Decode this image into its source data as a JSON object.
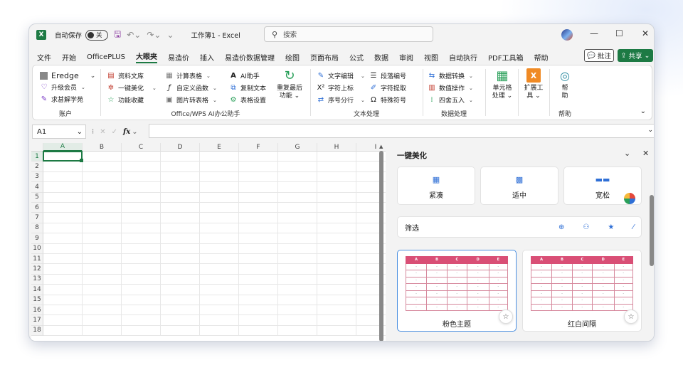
{
  "titlebar": {
    "app_icon": "X",
    "autosave_label": "自动保存",
    "autosave_state": "关",
    "doc_title": "工作簿1 - Excel",
    "search_placeholder": "搜索"
  },
  "menu": [
    "文件",
    "开始",
    "OfficePLUS",
    "大眼夹",
    "易造价",
    "插入",
    "易造价数据管理",
    "绘图",
    "页面布局",
    "公式",
    "数据",
    "审阅",
    "视图",
    "自动执行",
    "PDF工具箱",
    "帮助"
  ],
  "menu_active_index": 3,
  "header_buttons": {
    "comment": "批注",
    "share": "共享"
  },
  "ribbon": {
    "account": {
      "items": [
        "Eredge",
        "升级会员",
        "求甚解学苑"
      ],
      "label": "账户"
    },
    "assistant": {
      "col1": [
        "资料文库",
        "一键美化",
        "功能收藏"
      ],
      "col2": [
        "计算表格",
        "自定义函数",
        "图片转表格"
      ],
      "col3": [
        "AI助手",
        "复制文本",
        "表格设置"
      ],
      "label": "Office/WPS AI办公助手"
    },
    "repeat": {
      "line1": "重复最后",
      "line2": "功能"
    },
    "text": {
      "col1": [
        "文字编辑",
        "字符上标",
        "序号分行"
      ],
      "col2": [
        "段落编号",
        "字符提取",
        "特殊符号"
      ],
      "label": "文本处理"
    },
    "data": {
      "items": [
        "数据转换",
        "数值操作",
        "四舍五入"
      ],
      "label": "数据处理"
    },
    "cell": {
      "line1": "单元格",
      "line2": "处理"
    },
    "ext": {
      "line1": "扩展工",
      "line2": "具"
    },
    "help": {
      "line1": "帮",
      "line2": "助",
      "label": "帮助"
    }
  },
  "formula_bar": {
    "name_box": "A1",
    "fx": "fx"
  },
  "sheet": {
    "columns": [
      "A",
      "B",
      "C",
      "D",
      "E",
      "F",
      "G",
      "H",
      "I"
    ],
    "rows": [
      "1",
      "2",
      "3",
      "4",
      "5",
      "6",
      "7",
      "8",
      "9",
      "10",
      "11",
      "12",
      "13",
      "14",
      "15",
      "16",
      "17",
      "18"
    ],
    "selected_cell": "A1"
  },
  "panel": {
    "title": "一键美化",
    "density": [
      "紧凑",
      "适中",
      "宽松"
    ],
    "filter_label": "筛选",
    "themes": [
      {
        "name": "粉色主题",
        "selected": true
      },
      {
        "name": "红白间隔",
        "selected": false
      }
    ],
    "thumb_headers": [
      "A",
      "B",
      "C",
      "D",
      "E"
    ],
    "thumb_cell": "-"
  },
  "colors": {
    "excel_green": "#1d7a44",
    "pink_header": "#d94f76",
    "accent_blue": "#2f6fd6"
  }
}
